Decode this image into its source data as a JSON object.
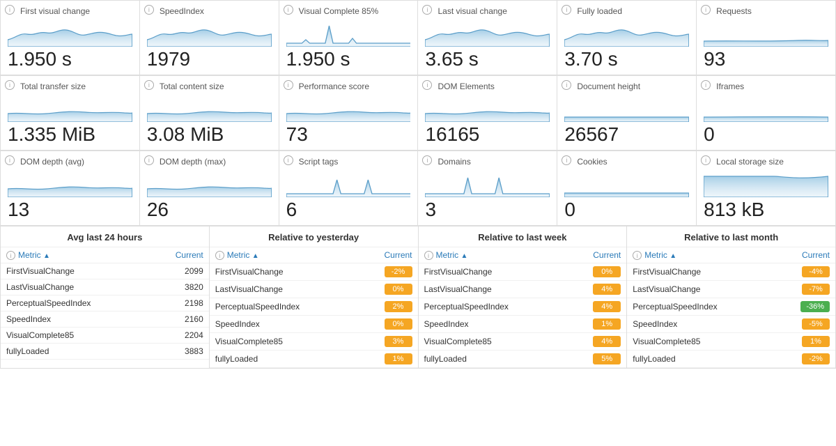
{
  "metrics_row1": [
    {
      "title": "First visual change",
      "value": "1.950 s",
      "sparkline": "wave"
    },
    {
      "title": "SpeedIndex",
      "value": "1979",
      "sparkline": "wave"
    },
    {
      "title": "Visual Complete 85%",
      "value": "1.950 s",
      "sparkline": "spike"
    },
    {
      "title": "Last visual change",
      "value": "3.65 s",
      "sparkline": "wave"
    },
    {
      "title": "Fully loaded",
      "value": "3.70 s",
      "sparkline": "wave"
    },
    {
      "title": "Requests",
      "value": "93",
      "sparkline": "flat"
    }
  ],
  "metrics_row2": [
    {
      "title": "Total transfer size",
      "value": "1.335 MiB",
      "sparkline": "wave2"
    },
    {
      "title": "Total content size",
      "value": "3.08 MiB",
      "sparkline": "wave2"
    },
    {
      "title": "Performance score",
      "value": "73",
      "sparkline": "wave2"
    },
    {
      "title": "DOM Elements",
      "value": "16165",
      "sparkline": "wave2"
    },
    {
      "title": "Document height",
      "value": "26567",
      "sparkline": "flat2"
    },
    {
      "title": "Iframes",
      "value": "0",
      "sparkline": "line"
    }
  ],
  "metrics_row3": [
    {
      "title": "DOM depth (avg)",
      "value": "13",
      "sparkline": "wave2"
    },
    {
      "title": "DOM depth (max)",
      "value": "26",
      "sparkline": "wave2"
    },
    {
      "title": "Script tags",
      "value": "6",
      "sparkline": "spike2"
    },
    {
      "title": "Domains",
      "value": "3",
      "sparkline": "spike3"
    },
    {
      "title": "Cookies",
      "value": "0",
      "sparkline": "line2"
    },
    {
      "title": "Local storage size",
      "value": "813 kB",
      "sparkline": "flat3"
    }
  ],
  "tables": [
    {
      "title": "Avg last 24 hours",
      "col1": "Metric",
      "col2": "Current",
      "rows": [
        {
          "metric": "FirstVisualChange",
          "value": "2099",
          "badge": null,
          "badge_type": null
        },
        {
          "metric": "LastVisualChange",
          "value": "3820",
          "badge": null,
          "badge_type": null
        },
        {
          "metric": "PerceptualSpeedIndex",
          "value": "2198",
          "badge": null,
          "badge_type": null
        },
        {
          "metric": "SpeedIndex",
          "value": "2160",
          "badge": null,
          "badge_type": null
        },
        {
          "metric": "VisualComplete85",
          "value": "2204",
          "badge": null,
          "badge_type": null
        },
        {
          "metric": "fullyLoaded",
          "value": "3883",
          "badge": null,
          "badge_type": null
        }
      ]
    },
    {
      "title": "Relative to yesterday",
      "col1": "Metric",
      "col2": "Current",
      "rows": [
        {
          "metric": "FirstVisualChange",
          "value": null,
          "badge": "-2%",
          "badge_type": "orange"
        },
        {
          "metric": "LastVisualChange",
          "value": null,
          "badge": "0%",
          "badge_type": "orange"
        },
        {
          "metric": "PerceptualSpeedIndex",
          "value": null,
          "badge": "2%",
          "badge_type": "orange"
        },
        {
          "metric": "SpeedIndex",
          "value": null,
          "badge": "0%",
          "badge_type": "orange"
        },
        {
          "metric": "VisualComplete85",
          "value": null,
          "badge": "3%",
          "badge_type": "orange"
        },
        {
          "metric": "fullyLoaded",
          "value": null,
          "badge": "1%",
          "badge_type": "orange"
        }
      ]
    },
    {
      "title": "Relative to last week",
      "col1": "Metric",
      "col2": "Current",
      "rows": [
        {
          "metric": "FirstVisualChange",
          "value": null,
          "badge": "0%",
          "badge_type": "orange"
        },
        {
          "metric": "LastVisualChange",
          "value": null,
          "badge": "4%",
          "badge_type": "orange"
        },
        {
          "metric": "PerceptualSpeedIndex",
          "value": null,
          "badge": "4%",
          "badge_type": "orange"
        },
        {
          "metric": "SpeedIndex",
          "value": null,
          "badge": "1%",
          "badge_type": "orange"
        },
        {
          "metric": "VisualComplete85",
          "value": null,
          "badge": "4%",
          "badge_type": "orange"
        },
        {
          "metric": "fullyLoaded",
          "value": null,
          "badge": "5%",
          "badge_type": "orange"
        }
      ]
    },
    {
      "title": "Relative to last month",
      "col1": "Metric",
      "col2": "Current",
      "rows": [
        {
          "metric": "FirstVisualChange",
          "value": null,
          "badge": "-4%",
          "badge_type": "orange"
        },
        {
          "metric": "LastVisualChange",
          "value": null,
          "badge": "-7%",
          "badge_type": "orange"
        },
        {
          "metric": "PerceptualSpeedIndex",
          "value": null,
          "badge": "-36%",
          "badge_type": "green"
        },
        {
          "metric": "SpeedIndex",
          "value": null,
          "badge": "-5%",
          "badge_type": "orange"
        },
        {
          "metric": "VisualComplete85",
          "value": null,
          "badge": "1%",
          "badge_type": "orange"
        },
        {
          "metric": "fullyLoaded",
          "value": null,
          "badge": "-2%",
          "badge_type": "orange"
        }
      ]
    }
  ]
}
